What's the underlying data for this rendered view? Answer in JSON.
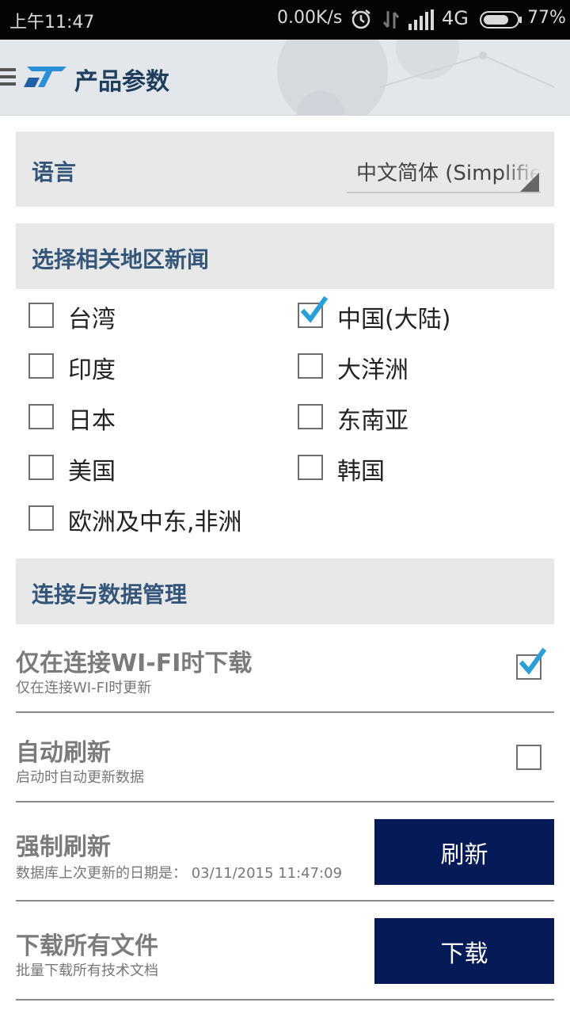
{
  "status_bar": {
    "time": "上午11:47",
    "net_speed": "0.00K/s",
    "network_type": "4G",
    "battery": "77%"
  },
  "toolbar": {
    "title": "产品参数",
    "logo_icon": "st-logo",
    "menu_icon": "hamburger-menu-icon"
  },
  "language": {
    "label": "语言",
    "selected": "中文简体 (Simplified)"
  },
  "news": {
    "header": "选择相关地区新闻",
    "regions": [
      {
        "label": "台湾",
        "checked": false
      },
      {
        "label": "中国(大陆)",
        "checked": true
      },
      {
        "label": "印度",
        "checked": false
      },
      {
        "label": "大洋洲",
        "checked": false
      },
      {
        "label": "日本",
        "checked": false
      },
      {
        "label": "东南亚",
        "checked": false
      },
      {
        "label": "美国",
        "checked": false
      },
      {
        "label": "韩国",
        "checked": false
      },
      {
        "label": "欧洲及中东,非洲",
        "checked": false
      }
    ]
  },
  "connection": {
    "header": "连接与数据管理",
    "wifi_only": {
      "title": "仅在连接WI-FI时下载",
      "subtitle": "仅在连接WI-FI时更新",
      "checked": true
    },
    "auto_refresh": {
      "title": "自动刷新",
      "subtitle": "启动时自动更新数据",
      "checked": false
    },
    "force_refresh": {
      "title": "强制刷新",
      "subtitle": "数据库上次更新的日期是： 03/11/2015 11:47:09",
      "button": "刷新"
    },
    "download_all": {
      "title": "下载所有文件",
      "subtitle": "批量下载所有技术文档",
      "button": "下载"
    }
  },
  "colors": {
    "accent_button": "#051a57",
    "header_text": "#34567a",
    "check_blue": "#2a9fd6"
  }
}
